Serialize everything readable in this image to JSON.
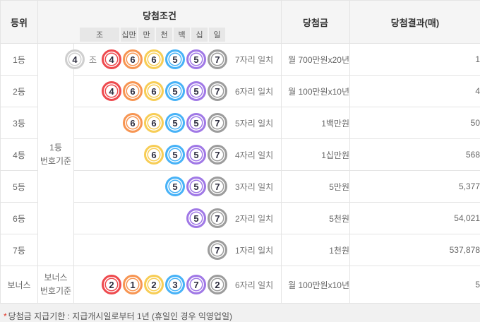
{
  "table": {
    "headers": {
      "rank": "등위",
      "condition": "당첨조건",
      "prize": "당첨금",
      "result": "당첨결과(매)"
    },
    "digit_labels": [
      "조",
      "십만",
      "만",
      "천",
      "백",
      "십",
      "일"
    ],
    "group_labels": {
      "main": [
        "1등",
        "번호기준"
      ],
      "bonus": [
        "보너스",
        "번호기준"
      ]
    },
    "palette": {
      "jo": "#cfcfcf",
      "sibman": "#ee4a4e",
      "man": "#f79552",
      "cheon": "#f7cd55",
      "baek": "#47b2f7",
      "sip": "#a078e6",
      "il": "#9c9c9c"
    },
    "rows": [
      {
        "rank": "1등",
        "jo_ball": {
          "value": "4",
          "color": "jo"
        },
        "jo_label": "조",
        "balls": [
          {
            "value": "4",
            "color": "sibman"
          },
          {
            "value": "6",
            "color": "man"
          },
          {
            "value": "6",
            "color": "cheon"
          },
          {
            "value": "5",
            "color": "baek"
          },
          {
            "value": "5",
            "color": "sip"
          },
          {
            "value": "7",
            "color": "il"
          }
        ],
        "match": "7자리 일치",
        "prize": "월 700만원x20년",
        "result": "1"
      },
      {
        "rank": "2등",
        "balls": [
          {
            "value": "4",
            "color": "sibman"
          },
          {
            "value": "6",
            "color": "man"
          },
          {
            "value": "6",
            "color": "cheon"
          },
          {
            "value": "5",
            "color": "baek"
          },
          {
            "value": "5",
            "color": "sip"
          },
          {
            "value": "7",
            "color": "il"
          }
        ],
        "match": "6자리 일치",
        "prize": "월 100만원x10년",
        "result": "4"
      },
      {
        "rank": "3등",
        "balls": [
          {
            "value": "6",
            "color": "man"
          },
          {
            "value": "6",
            "color": "cheon"
          },
          {
            "value": "5",
            "color": "baek"
          },
          {
            "value": "5",
            "color": "sip"
          },
          {
            "value": "7",
            "color": "il"
          }
        ],
        "match": "5자리 일치",
        "prize": "1백만원",
        "result": "50"
      },
      {
        "rank": "4등",
        "balls": [
          {
            "value": "6",
            "color": "cheon"
          },
          {
            "value": "5",
            "color": "baek"
          },
          {
            "value": "5",
            "color": "sip"
          },
          {
            "value": "7",
            "color": "il"
          }
        ],
        "match": "4자리 일치",
        "prize": "1십만원",
        "result": "568"
      },
      {
        "rank": "5등",
        "balls": [
          {
            "value": "5",
            "color": "baek"
          },
          {
            "value": "5",
            "color": "sip"
          },
          {
            "value": "7",
            "color": "il"
          }
        ],
        "match": "3자리 일치",
        "prize": "5만원",
        "result": "5,377"
      },
      {
        "rank": "6등",
        "balls": [
          {
            "value": "5",
            "color": "sip"
          },
          {
            "value": "7",
            "color": "il"
          }
        ],
        "match": "2자리 일치",
        "prize": "5천원",
        "result": "54,021"
      },
      {
        "rank": "7등",
        "balls": [
          {
            "value": "7",
            "color": "il"
          }
        ],
        "match": "1자리 일치",
        "prize": "1천원",
        "result": "537,878"
      },
      {
        "rank": "보너스",
        "is_bonus": true,
        "balls": [
          {
            "value": "2",
            "color": "sibman"
          },
          {
            "value": "1",
            "color": "man"
          },
          {
            "value": "2",
            "color": "cheon"
          },
          {
            "value": "3",
            "color": "baek"
          },
          {
            "value": "7",
            "color": "sip"
          },
          {
            "value": "2",
            "color": "il"
          }
        ],
        "match": "6자리 일치",
        "prize": "월 100만원x10년",
        "result": "5"
      }
    ]
  },
  "footnote": {
    "mark": "*",
    "text": "당첨금 지급기한 : 지급개시일로부터 1년 (휴일인 경우 익영업일)"
  }
}
